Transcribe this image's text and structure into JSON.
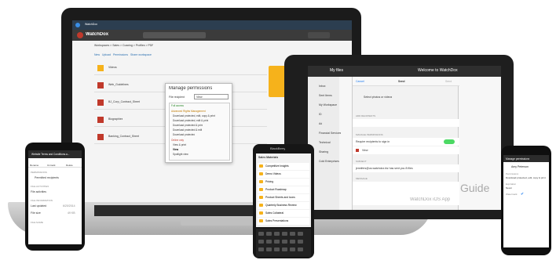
{
  "laptop": {
    "browser_tab": "WatchDox",
    "app_name": "WatchDox",
    "breadcrumb": [
      "Workspaces",
      "Sales",
      "Coaxing",
      "Profiles",
      "PDF"
    ],
    "toolbar": [
      "New",
      "Upload",
      "Permissions",
      "Share workspace"
    ],
    "files": [
      {
        "name": "Videos",
        "meta": ""
      },
      {
        "name": "Web_Guidelines",
        "meta": ""
      },
      {
        "name": "BJ_Corp_Contract_Sheet",
        "meta": ""
      },
      {
        "name": "Biographies",
        "meta": ""
      },
      {
        "name": "Banking_Contract_Sheet",
        "meta": ""
      }
    ],
    "dialog": {
      "title": "Manage permissions",
      "row_label": "File recipient",
      "select_value": "View",
      "options": [
        "Full access",
        "Advanced Rights Management",
        "Download protected, edit, copy & print",
        "Download protected, edit & print",
        "Download protected & print",
        "Download protected & edit",
        "Download protected",
        "Online only",
        "View & print",
        "View",
        "Spotlight view"
      ]
    }
  },
  "ipad": {
    "status_left": "iPad",
    "my_files": "My files",
    "welcome": "Welcome to WatchDox",
    "sidebar": [
      "Inbox",
      "Sent Items",
      "My Workspace",
      "ID",
      "Ad",
      "Financial Services",
      "Technical",
      "Sharing",
      "Cold Enterprises"
    ],
    "dialog": {
      "cancel": "Cancel",
      "title": "Send",
      "send": "Send",
      "select_photos": "Select photos or videos",
      "section_recipients": "ADD RECIPIENTS",
      "section_permissions": "MANAGE PERMISSIONS",
      "require_signin": "Require recipients to sign in",
      "permission": "View",
      "section_subject": "SUBJECT",
      "subject_value": "jennifers@us.watchdox.biz has sent you 8 files",
      "section_message": "MESSAGE"
    },
    "overlay_text": "Guide",
    "overlay_sub": "WatchDox iOS App"
  },
  "android": {
    "title": "Website Terms and Conditions.a...",
    "actions": [
      "Rename",
      "Unmark",
      "Delete"
    ],
    "section_permissions": "PERMISSIONS",
    "permission_value": "Permitted recipients",
    "section_activities": "FILE ACTIVITIES",
    "activities_link": "File activities",
    "section_info": "FILE INFORMATION",
    "last_updated_label": "Last updated",
    "last_updated_value": "6/20/2014",
    "size_label": "File size",
    "size_value": "49 KB",
    "section_more": "FILE NAME"
  },
  "blackberry": {
    "brand": "BlackBerry",
    "header": "Sales Materials",
    "folders": [
      "Competitive Insights",
      "Demo Videos",
      "Pricing",
      "Product Roadmap",
      "Product Sheets and Icons",
      "Quarterly Business Review",
      "Sales Collateral",
      "Sales Presentations"
    ]
  },
  "winphone": {
    "title": "Manage permissions",
    "user": "Amy Peterson",
    "label1": "Permissions",
    "value1": "Download protected, edit, copy & print",
    "label2": "Expiration",
    "value2": "Never",
    "label3": "Watermark"
  },
  "colors": {
    "accent_red": "#c0392b",
    "folder_yellow": "#f6b21b",
    "toggle_green": "#4cd964",
    "ios_blue": "#1e7cf0"
  }
}
